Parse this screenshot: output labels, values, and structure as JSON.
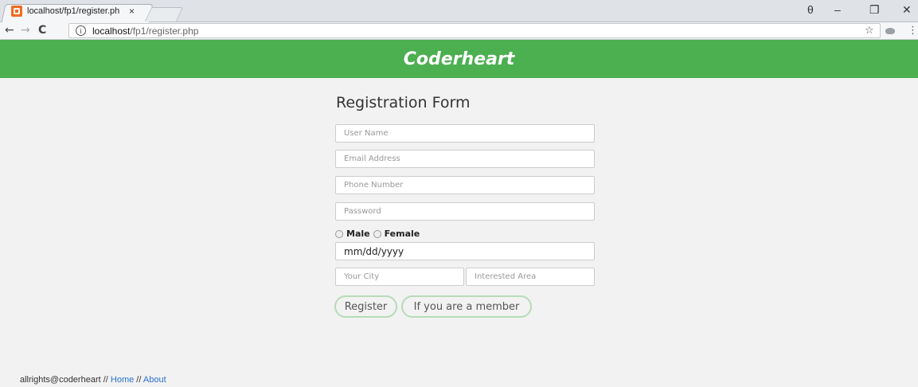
{
  "browser": {
    "tab_title": "localhost/fp1/register.ph",
    "tab_close": "×",
    "url_host": "localhost",
    "url_path": "/fp1/register.php",
    "back": "←",
    "forward": "→",
    "reload": "C",
    "info": "i",
    "star": "☆",
    "profile": "θ",
    "minimize": "–",
    "restore": "❐",
    "close": "✕",
    "menu": "⋮"
  },
  "header": {
    "title": "Coderheart"
  },
  "form": {
    "title": "Registration Form",
    "username_placeholder": "User Name",
    "email_placeholder": "Email Address",
    "phone_placeholder": "Phone Number",
    "password_placeholder": "Password",
    "gender_male": "Male",
    "gender_female": "Female",
    "date_value": "mm/dd/yyyy",
    "city_placeholder": "Your City",
    "interest_placeholder": "Interested Area",
    "register_label": "Register",
    "member_label": "If you are a member"
  },
  "footer": {
    "text": "allrights@coderheart",
    "sep1": " // ",
    "home": "Home",
    "sep2": " // ",
    "about": "About"
  },
  "colors": {
    "header_green": "#4caf50",
    "link_blue": "#2a6fd1"
  }
}
